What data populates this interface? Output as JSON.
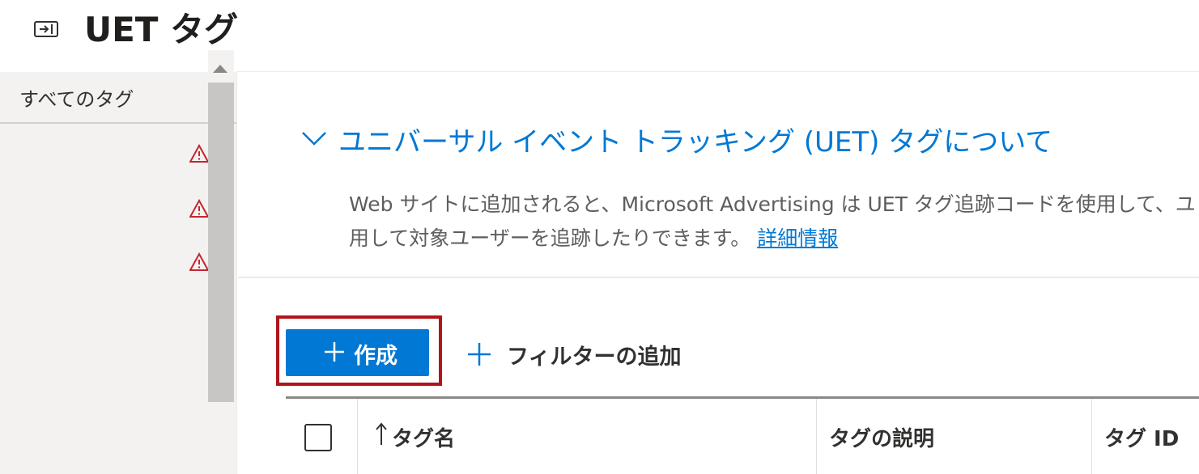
{
  "header": {
    "title": "UET タグ",
    "collapse_icon": "panel-collapse-icon"
  },
  "sidebar": {
    "tab_label": "すべてのタグ",
    "warning_icon": "warning-triangle-icon",
    "warning_color": "#c4262e"
  },
  "about": {
    "title": "ユニバーサル イベント トラッキング (UET) タグについて",
    "text_line1": "Web サイトに追加されると、Microsoft Advertising は UET タグ追跡コードを使用して、ユ",
    "text_line2": "用して対象ユーザーを追跡したりできます。",
    "learn_more": "詳細情報",
    "accent_color": "#0078d4"
  },
  "toolbar": {
    "create_label": "作成",
    "filter_label": "フィルターの追加",
    "highlight_color": "#b0151b"
  },
  "table": {
    "columns": [
      "タグ名",
      "タグの説明",
      "タグ ID"
    ],
    "sort_icon": "sort-up-icon"
  }
}
